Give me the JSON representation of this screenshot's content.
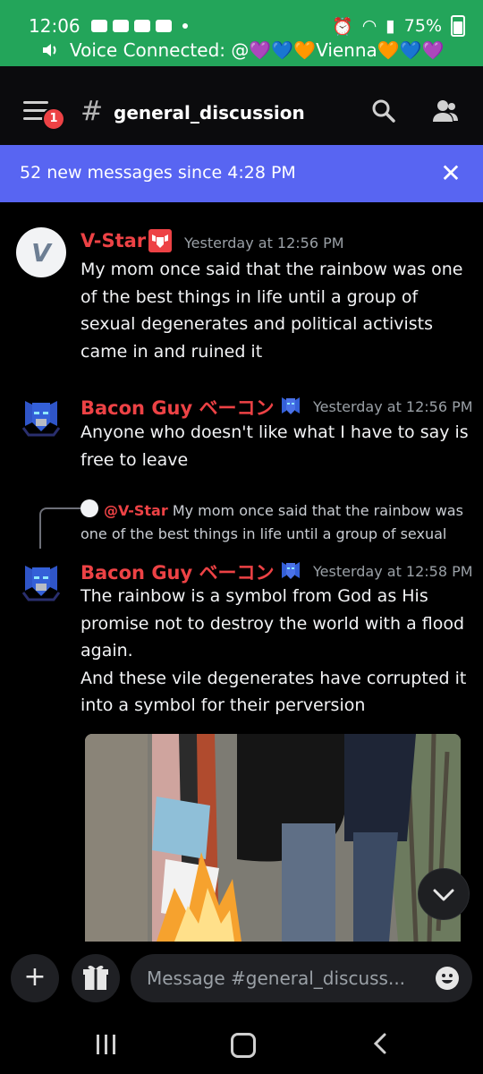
{
  "status_bar": {
    "time": "12:06",
    "battery": "75%",
    "voice_banner": "Voice Connected: @💜💙🧡Vienna🧡💙💜"
  },
  "header": {
    "notification_count": "1",
    "hash": "#",
    "channel_name": "general_discussion"
  },
  "new_messages_bar": {
    "text": "52 new messages since 4:28 PM",
    "close_glyph": "✕"
  },
  "messages": [
    {
      "author": "V-Star",
      "avatar_letter": "V",
      "timestamp": "Yesterday at 12:56 PM",
      "text": "My mom once said that the rainbow was one of the best things in life until a group of sexual degenerates and political activists came in and ruined it"
    },
    {
      "author": "Bacon Guy ベーコン",
      "timestamp": "Yesterday at 12:56 PM",
      "text": "Anyone who doesn't like what I have to say is free to leave"
    },
    {
      "reply_author": "@V-Star",
      "reply_text": "My mom once said that the rainbow was one of the best things in life until a group of sexual",
      "author": "Bacon Guy ベーコン",
      "timestamp": "Yesterday at 12:58 PM",
      "text": "The rainbow is a symbol from God as His promise not to destroy the world with a flood again.\nAnd these vile degenerates have corrupted it into a symbol for their perversion"
    }
  ],
  "composer": {
    "plus": "+",
    "placeholder": "Message #general_discuss..."
  },
  "colors": {
    "status_green": "#23a55a",
    "blurple": "#5865f2",
    "username_red": "#ed4245"
  }
}
